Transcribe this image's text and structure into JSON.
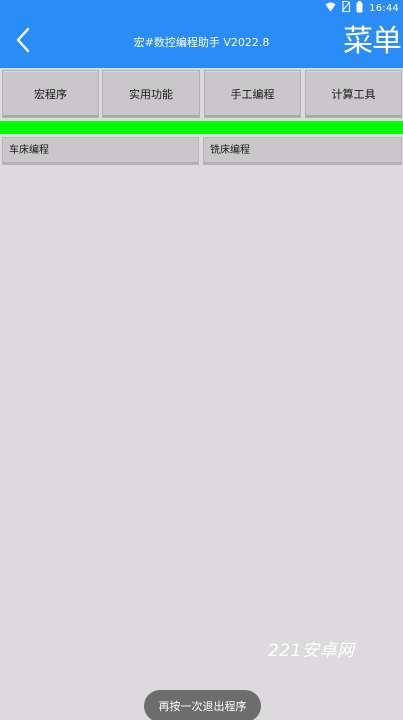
{
  "status_bar": {
    "time": "16:44",
    "icons": [
      "wifi-icon",
      "no-sim-icon",
      "battery-icon"
    ]
  },
  "app_bar": {
    "back_icon": "chevron-left-icon",
    "title": "宏#数控编程助手 V2022.8",
    "menu_label": "菜单",
    "background_color": "#2a8cf7"
  },
  "top_tabs": [
    {
      "label": "宏程序"
    },
    {
      "label": "实用功能"
    },
    {
      "label": "手工编程"
    },
    {
      "label": "计算工具"
    }
  ],
  "indicator_color": "#00ff00",
  "sub_buttons": [
    {
      "label": "车床编程"
    },
    {
      "label": "铣床编程"
    }
  ],
  "watermark": "221安卓网",
  "toast": "再按一次退出程序"
}
